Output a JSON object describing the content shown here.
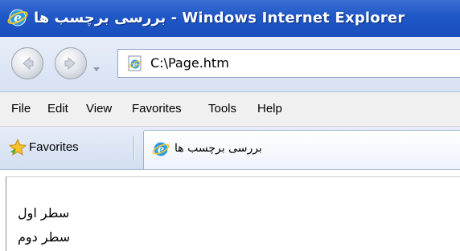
{
  "window": {
    "title": "بررسی برچسب ها - Windows Internet Explorer"
  },
  "address_bar": {
    "url": "C:\\Page.htm"
  },
  "menu": {
    "items": [
      "File",
      "Edit",
      "View",
      "Favorites",
      "Tools",
      "Help"
    ]
  },
  "favorites_bar": {
    "favorites_label": "Favorites",
    "tab_title": "بررسی برچسب ها"
  },
  "content": {
    "lines": [
      "سطر اول",
      "سطر دوم"
    ]
  },
  "colors": {
    "titlebar": "#1f57c6",
    "menubar": "#f0f0f0",
    "favorites_bar": "#d3def0"
  },
  "icons": [
    "ie-logo-icon",
    "back-arrow-icon",
    "forward-arrow-icon",
    "dropdown-icon",
    "page-icon",
    "star-icon"
  ]
}
